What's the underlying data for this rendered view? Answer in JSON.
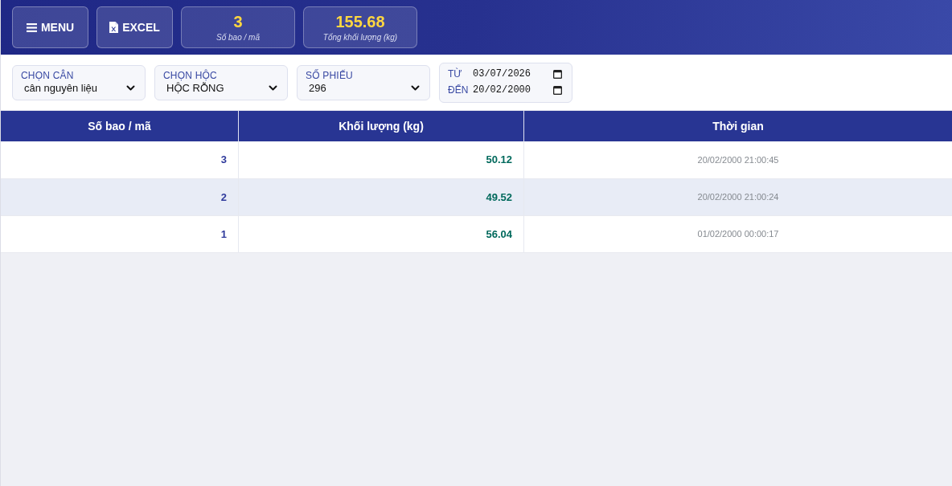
{
  "header": {
    "buttons": [
      {
        "kind": "menu",
        "label": "MENU"
      },
      {
        "kind": "excel",
        "label": "EXCEL"
      }
    ],
    "stats": [
      {
        "value": "3",
        "label": "Số bao / mã"
      },
      {
        "value": "155.68",
        "label": "Tổng khối lượng (kg)"
      }
    ]
  },
  "filters": [
    {
      "label": "CHỌN CÂN",
      "value": "cân nguyên liệu"
    },
    {
      "label": "CHỌN HỘC",
      "value": "HỘC RỖNG"
    },
    {
      "label": "SỐ PHIẾU",
      "value": "296"
    }
  ],
  "date_range": [
    {
      "label": "TỪ",
      "value": "03/07/2026"
    },
    {
      "label": "ĐẾN",
      "value": "20/02/2000"
    }
  ],
  "table": {
    "columns": [
      "Số bao / mã",
      "Khối lượng (kg)",
      "Thời gian"
    ],
    "rows": [
      [
        "3",
        "50.12",
        "20/02/2000 21:00:45"
      ],
      [
        "2",
        "49.52",
        "20/02/2000 21:00:24"
      ],
      [
        "1",
        "56.04",
        "01/02/2000 00:00:17"
      ]
    ]
  }
}
